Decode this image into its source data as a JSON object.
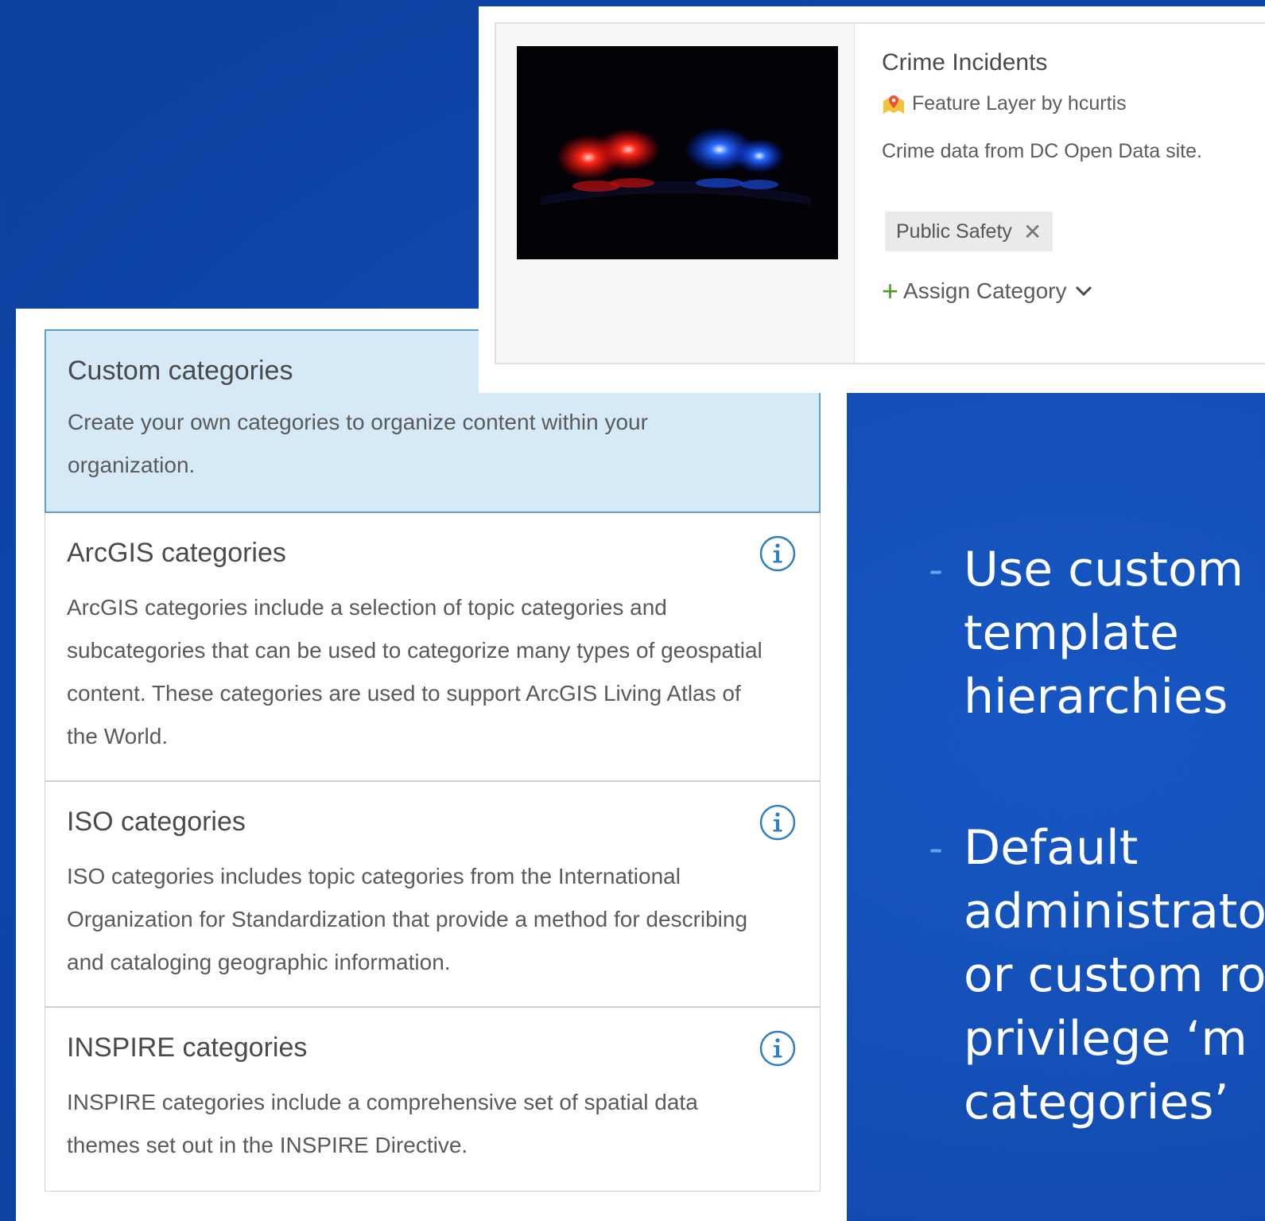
{
  "item_card": {
    "title": "Crime Incidents",
    "meta": "Feature Layer by hcurtis",
    "description": "Crime data from DC Open Data site.",
    "category_chip": "Public Safety",
    "chip_remove": "✕",
    "assign_label": "Assign Category",
    "assign_plus": "+"
  },
  "categories": [
    {
      "title": "Custom categories",
      "description": "Create your own categories to organize content within your organization.",
      "selected": true
    },
    {
      "title": "ArcGIS categories",
      "description": "ArcGIS categories include a selection of topic categories and subcategories that can be used to categorize many types of geospatial content. These categories are used to support ArcGIS Living Atlas of the World."
    },
    {
      "title": "ISO categories",
      "description": "ISO categories includes topic categories from the International Organization for Standardization that provide a method for describing and cataloging geographic information."
    },
    {
      "title": "INSPIRE categories",
      "description": "INSPIRE categories include a comprehensive set of spatial data themes set out in the INSPIRE Directive."
    }
  ],
  "bullets": [
    {
      "dash": "-",
      "lines": [
        "Use custom",
        "template",
        "hierarchies"
      ]
    },
    {
      "dash": "-",
      "lines": [
        "Default",
        "administrato",
        "or custom ro",
        "privilege ‘m",
        "categories’"
      ]
    }
  ],
  "colors": {
    "background": "#134fb6",
    "selected_bg": "#d6e9f7",
    "selected_border": "#5a9fd4",
    "info_icon": "#2f7fc6",
    "plus_green": "#4c9a2a",
    "bullet_dash": "#5ea6ee"
  },
  "icons": {
    "info": "info-icon",
    "layer": "feature-layer-icon",
    "chevron": "chevron-down-icon"
  }
}
